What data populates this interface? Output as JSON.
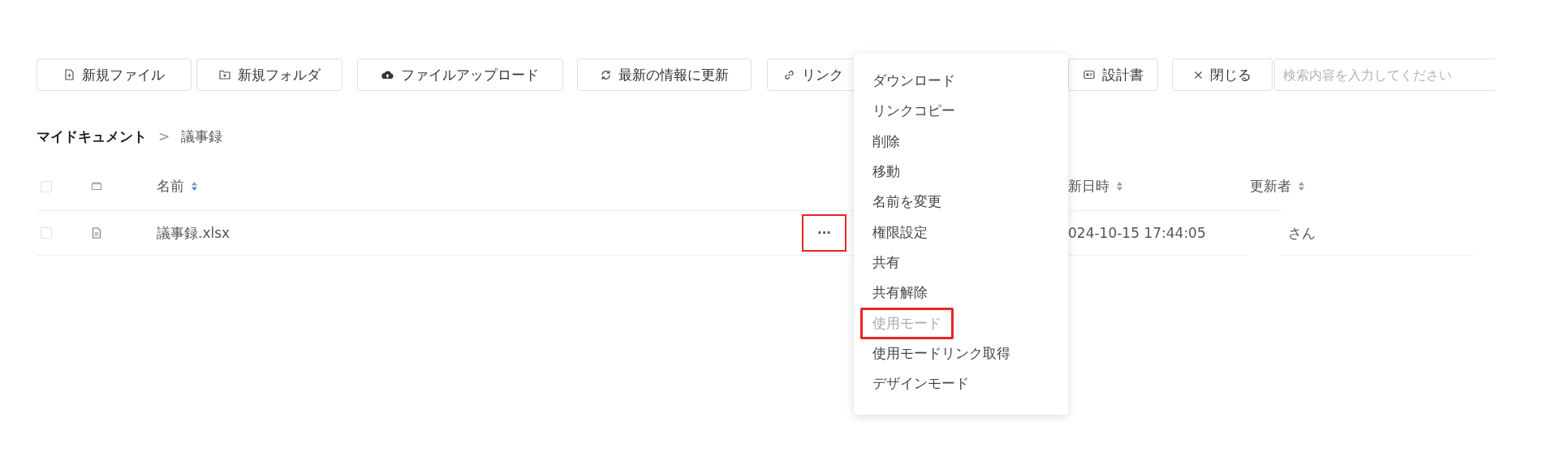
{
  "toolbar": {
    "buttons": [
      {
        "kind": "new-file",
        "label": "新規ファイル"
      },
      {
        "kind": "new-folder",
        "label": "新規フォルダ"
      },
      {
        "kind": "upload",
        "label": "ファイルアップロード"
      },
      {
        "kind": "refresh",
        "label": "最新の情報に更新"
      },
      {
        "kind": "link",
        "label": "リンク"
      },
      {
        "kind": "spec",
        "label": "設計書"
      },
      {
        "kind": "close",
        "label": "閉じる"
      }
    ],
    "search": {
      "placeholder": "検索内容を入力してください"
    }
  },
  "breadcrumb": [
    {
      "label": "マイドキュメント",
      "current": false
    },
    {
      "label": "議事録",
      "current": true
    }
  ],
  "breadcrumb_separator": ">",
  "table": {
    "columns": [
      {
        "kind": "checkbox",
        "checked": false
      },
      {
        "kind": "type-icon"
      },
      {
        "kind": "name",
        "label": "名前",
        "sorted": true
      },
      {
        "kind": "date",
        "label": "新日時",
        "sorted": false
      },
      {
        "kind": "user",
        "label": "更新者",
        "sorted": false
      }
    ],
    "rows": [
      {
        "checked": false,
        "name": "議事録.xlsx",
        "actions": "···",
        "actions_highlighted": true,
        "date": "024-10-15 17:44:05",
        "user": "さん"
      }
    ]
  },
  "context_menu": {
    "items": [
      {
        "label": "ダウンロード",
        "disabled": false,
        "highlighted": false
      },
      {
        "label": "リンクコピー",
        "disabled": false,
        "highlighted": false
      },
      {
        "label": "削除",
        "disabled": false,
        "highlighted": false
      },
      {
        "label": "移動",
        "disabled": false,
        "highlighted": false
      },
      {
        "label": "名前を変更",
        "disabled": false,
        "highlighted": false
      },
      {
        "label": "権限設定",
        "disabled": false,
        "highlighted": false
      },
      {
        "label": "共有",
        "disabled": false,
        "highlighted": false
      },
      {
        "label": "共有解除",
        "disabled": false,
        "highlighted": false
      },
      {
        "label": "使用モード",
        "disabled": true,
        "highlighted": true
      },
      {
        "label": "使用モードリンク取得",
        "disabled": false,
        "highlighted": false
      },
      {
        "label": "デザインモード",
        "disabled": false,
        "highlighted": false
      }
    ]
  }
}
